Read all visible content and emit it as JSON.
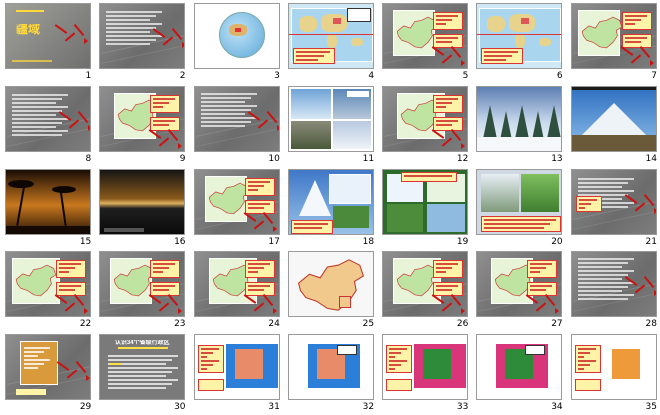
{
  "view": "slide-sorter",
  "slides": [
    {
      "number": "1",
      "theme": "gray",
      "title": "疆域"
    },
    {
      "number": "2",
      "theme": "gray",
      "title": ""
    },
    {
      "number": "3",
      "theme": "white-globe",
      "title": ""
    },
    {
      "number": "4",
      "theme": "worldmap",
      "title": ""
    },
    {
      "number": "5",
      "theme": "gray-map",
      "title": ""
    },
    {
      "number": "6",
      "theme": "worldmap",
      "title": ""
    },
    {
      "number": "7",
      "theme": "gray-map",
      "title": ""
    },
    {
      "number": "8",
      "theme": "gray",
      "title": ""
    },
    {
      "number": "9",
      "theme": "gray-map",
      "title": ""
    },
    {
      "number": "10",
      "theme": "gray",
      "title": ""
    },
    {
      "number": "11",
      "theme": "photos",
      "title": ""
    },
    {
      "number": "12",
      "theme": "gray-map",
      "title": ""
    },
    {
      "number": "13",
      "theme": "snow",
      "title": ""
    },
    {
      "number": "14",
      "theme": "mountain",
      "title": ""
    },
    {
      "number": "15",
      "theme": "sunset",
      "title": ""
    },
    {
      "number": "16",
      "theme": "sea-dark",
      "title": ""
    },
    {
      "number": "17",
      "theme": "gray-map",
      "title": ""
    },
    {
      "number": "18",
      "theme": "photos",
      "title": ""
    },
    {
      "number": "19",
      "theme": "photos",
      "title": ""
    },
    {
      "number": "20",
      "theme": "photos",
      "title": ""
    },
    {
      "number": "21",
      "theme": "gray",
      "title": ""
    },
    {
      "number": "22",
      "theme": "gray-map",
      "title": ""
    },
    {
      "number": "23",
      "theme": "gray-map",
      "title": ""
    },
    {
      "number": "24",
      "theme": "gray-map",
      "title": ""
    },
    {
      "number": "25",
      "theme": "white-map",
      "title": ""
    },
    {
      "number": "26",
      "theme": "gray-map",
      "title": ""
    },
    {
      "number": "27",
      "theme": "gray-map",
      "title": ""
    },
    {
      "number": "28",
      "theme": "gray",
      "title": ""
    },
    {
      "number": "29",
      "theme": "gray",
      "title": ""
    },
    {
      "number": "30",
      "theme": "gray",
      "title": "认识34个省级行政区"
    },
    {
      "number": "31",
      "theme": "province-beijing",
      "title": ""
    },
    {
      "number": "32",
      "theme": "province-beijing",
      "title": ""
    },
    {
      "number": "33",
      "theme": "province-jilin",
      "title": ""
    },
    {
      "number": "34",
      "theme": "province-jilin",
      "title": ""
    },
    {
      "number": "35",
      "theme": "province-qinghai",
      "title": ""
    }
  ],
  "colors": {
    "slide_gray": "#7c7c7c",
    "accent_red": "#cc1111",
    "highlight_yellow": "#fff3a8",
    "map_green": "#bfe3a0",
    "sea_blue": "#9fd4f0",
    "province_magenta": "#d8357a",
    "province_green": "#2e8b3a",
    "province_orange": "#ef9a3a",
    "province_salmon": "#e88b68"
  }
}
